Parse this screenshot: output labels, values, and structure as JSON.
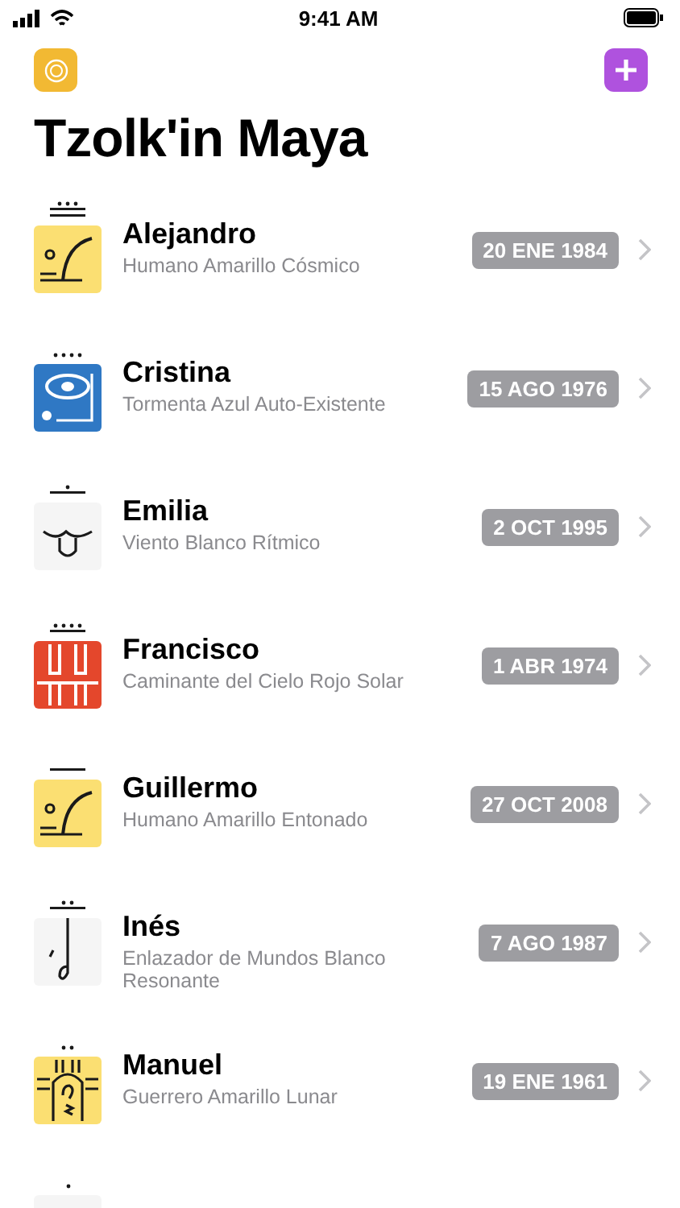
{
  "status_bar": {
    "time": "9:41 AM"
  },
  "toolbar": {
    "left_button": {
      "color": "#f2b933"
    },
    "right_button": {
      "color": "#af52de"
    }
  },
  "title": "Tzolk'in Maya",
  "people": [
    {
      "name": "Alejandro",
      "sign": "Humano Amarillo Cósmico",
      "date": "20 ENE 1984",
      "kind": "human",
      "color": "#fbdf72",
      "tone": [
        {
          "kind": "dot"
        },
        {
          "kind": "dot"
        },
        {
          "kind": "dot"
        },
        {
          "kind": "bar"
        },
        {
          "kind": "bar"
        }
      ]
    },
    {
      "name": "Cristina",
      "sign": "Tormenta Azul Auto-Existente",
      "date": "15 AGO 1976",
      "kind": "storm",
      "color": "#2f78c4",
      "tone": [
        {
          "kind": "dot"
        },
        {
          "kind": "dot"
        },
        {
          "kind": "dot"
        },
        {
          "kind": "dot"
        }
      ]
    },
    {
      "name": "Emilia",
      "sign": "Viento Blanco Rítmico",
      "date": "2 OCT 1995",
      "kind": "wind",
      "color": "#f5f5f5",
      "tone": [
        {
          "kind": "dot"
        },
        {
          "kind": "bar"
        }
      ]
    },
    {
      "name": "Francisco",
      "sign": "Caminante del Cielo Rojo Solar",
      "date": "1 ABR 1974",
      "kind": "skywalker",
      "color": "#e4472c",
      "tone": [
        {
          "kind": "dot"
        },
        {
          "kind": "dot"
        },
        {
          "kind": "dot"
        },
        {
          "kind": "dot"
        },
        {
          "kind": "bar"
        }
      ]
    },
    {
      "name": "Guillermo",
      "sign": "Humano Amarillo Entonado",
      "date": "27 OCT 2008",
      "kind": "human",
      "color": "#fbdf72",
      "tone": [
        {
          "kind": "bar"
        }
      ]
    },
    {
      "name": "Inés",
      "sign": "Enlazador de Mundos Blanco Resonante",
      "date": "7 AGO 1987",
      "kind": "worldbridger",
      "color": "#f5f5f5",
      "tone": [
        {
          "kind": "dot"
        },
        {
          "kind": "dot"
        },
        {
          "kind": "bar"
        }
      ]
    },
    {
      "name": "Manuel",
      "sign": "Guerrero Amarillo Lunar",
      "date": "19 ENE 1961",
      "kind": "warrior",
      "color": "#fbdf72",
      "tone": [
        {
          "kind": "dot"
        },
        {
          "kind": "dot"
        }
      ]
    },
    {
      "kind": "plain",
      "color": "#f5f5f5",
      "tone": [
        {
          "kind": "dot"
        }
      ]
    }
  ]
}
